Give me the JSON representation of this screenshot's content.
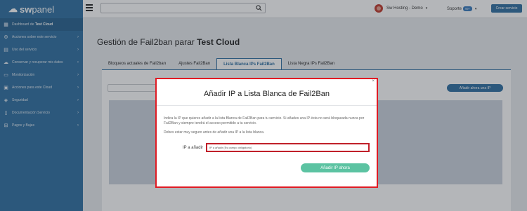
{
  "app": {
    "brand_mark": "☁",
    "brand_bold": "sw",
    "brand_light": "panel"
  },
  "sidebar": {
    "items": [
      {
        "label_prefix": "Dashboard de ",
        "label_bold": "Test Cloud",
        "icon": "dashboard-icon",
        "glyph": "▦",
        "chevron": ""
      },
      {
        "label_prefix": "Acciones sobre este servicio",
        "label_bold": "",
        "icon": "gear-icon",
        "glyph": "⚙",
        "chevron": "›"
      },
      {
        "label_prefix": "Uso del servicio",
        "label_bold": "",
        "icon": "chart-icon",
        "glyph": "▤",
        "chevron": "›"
      },
      {
        "label_prefix": "Conservar y recuperar mis datos",
        "label_bold": "",
        "icon": "cloud-icon",
        "glyph": "☁",
        "chevron": "›"
      },
      {
        "label_prefix": "Monitorización",
        "label_bold": "",
        "icon": "monitor-icon",
        "glyph": "▭",
        "chevron": "›"
      },
      {
        "label_prefix": "Acciones para este Cloud",
        "label_bold": "",
        "icon": "briefcase-icon",
        "glyph": "▣",
        "chevron": "›"
      },
      {
        "label_prefix": "Seguridad",
        "label_bold": "",
        "icon": "shield-icon",
        "glyph": "◈",
        "chevron": "›"
      },
      {
        "label_prefix": "Documentación Servicio",
        "label_bold": "",
        "icon": "document-icon",
        "glyph": "▯",
        "chevron": "›"
      },
      {
        "label_prefix": "Pagos y Bajas",
        "label_bold": "",
        "icon": "cart-icon",
        "glyph": "⊞",
        "chevron": "›"
      }
    ]
  },
  "topbar": {
    "search_placeholder": "",
    "user_label": "Sw Hosting - Demo",
    "caret": "▾",
    "support_label": "Soporte",
    "support_badge": "99+",
    "create_button": "Crear servicio"
  },
  "main": {
    "title_prefix": "Gestión de Fail2ban parar ",
    "title_bold": "Test Cloud",
    "tabs": [
      {
        "label": "Bloqueos actuales de Fail2ban"
      },
      {
        "label": "Ajustes Fail2Ban"
      },
      {
        "label": "Lista Blanca IPs Fail2Ban"
      },
      {
        "label": "Lista Negra IPs Fail2Ban"
      }
    ],
    "add_button": "Añadir ahora una IP"
  },
  "modal": {
    "close": "×",
    "title": "Añadir IP a Lista Blanca de Fail2Ban",
    "text1": "Indica la IP que quieres añadir a la lista Blanca de Fail2Ban para tu servicio. Si añades una IP ésta no será bloqueada nunca por Fail2Ban y siempre tendrá el acceso permitido a tu servicio.",
    "text2": "Debes estar muy seguro antes de añadir una IP a la lista blanca.",
    "ip_label": "IP a añadir",
    "ip_placeholder": "IP a añadir (Es campo obligatorio)",
    "submit": "Añadir IP ahora"
  }
}
